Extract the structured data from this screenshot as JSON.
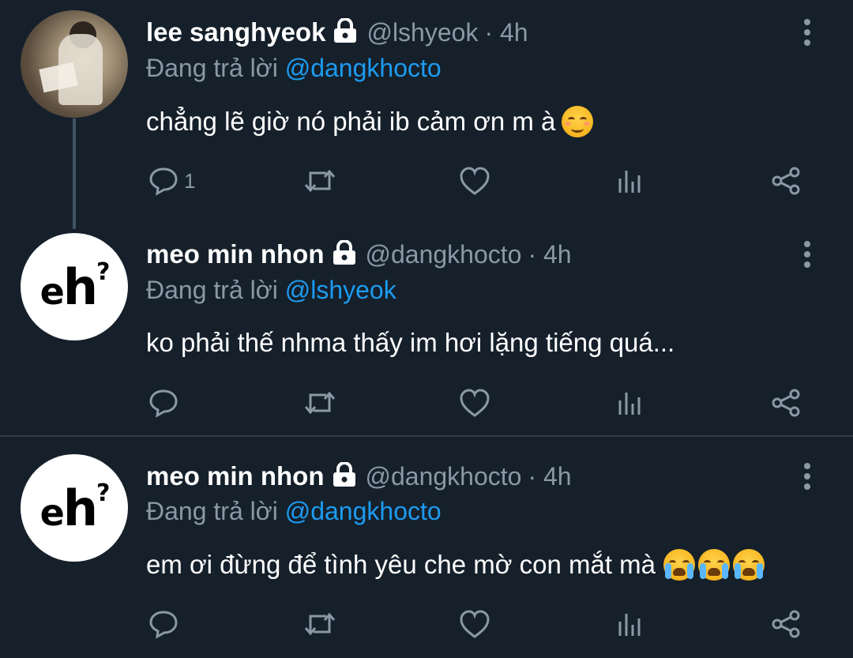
{
  "tweets": [
    {
      "name": "lee sanghyeok",
      "handle": "@lshyeok",
      "time": "· 4h",
      "reply_prefix": "Đang trả lời",
      "reply_to": "@dangkhocto",
      "text": "chẳng lẽ giờ nó phải ib cảm ơn m à",
      "reply_count": "1",
      "avatar": "photo"
    },
    {
      "name": "meo min nhon",
      "handle": "@dangkhocto",
      "time": "· 4h",
      "reply_prefix": "Đang trả lời",
      "reply_to": "@lshyeok",
      "text": "ko phải thế nhma thấy im hơi lặng tiếng quá...",
      "reply_count": "",
      "avatar": "eh"
    },
    {
      "name": "meo min nhon",
      "handle": "@dangkhocto",
      "time": "· 4h",
      "reply_prefix": "Đang trả lời",
      "reply_to": "@dangkhocto",
      "text": "em ơi đừng để tình yêu che mờ con mắt mà",
      "reply_count": "",
      "avatar": "eh"
    }
  ],
  "avatar_eh_text": {
    "e": "e",
    "h": "h",
    "q": "?"
  },
  "colors": {
    "background": "#15202b",
    "secondary_text": "#8b98a5",
    "mention": "#1d9bf0"
  },
  "icons": [
    "lock-icon",
    "reply-icon",
    "retweet-icon",
    "like-icon",
    "analytics-icon",
    "share-icon",
    "more-icon",
    "smiling-face-emoji",
    "crying-face-emoji"
  ]
}
